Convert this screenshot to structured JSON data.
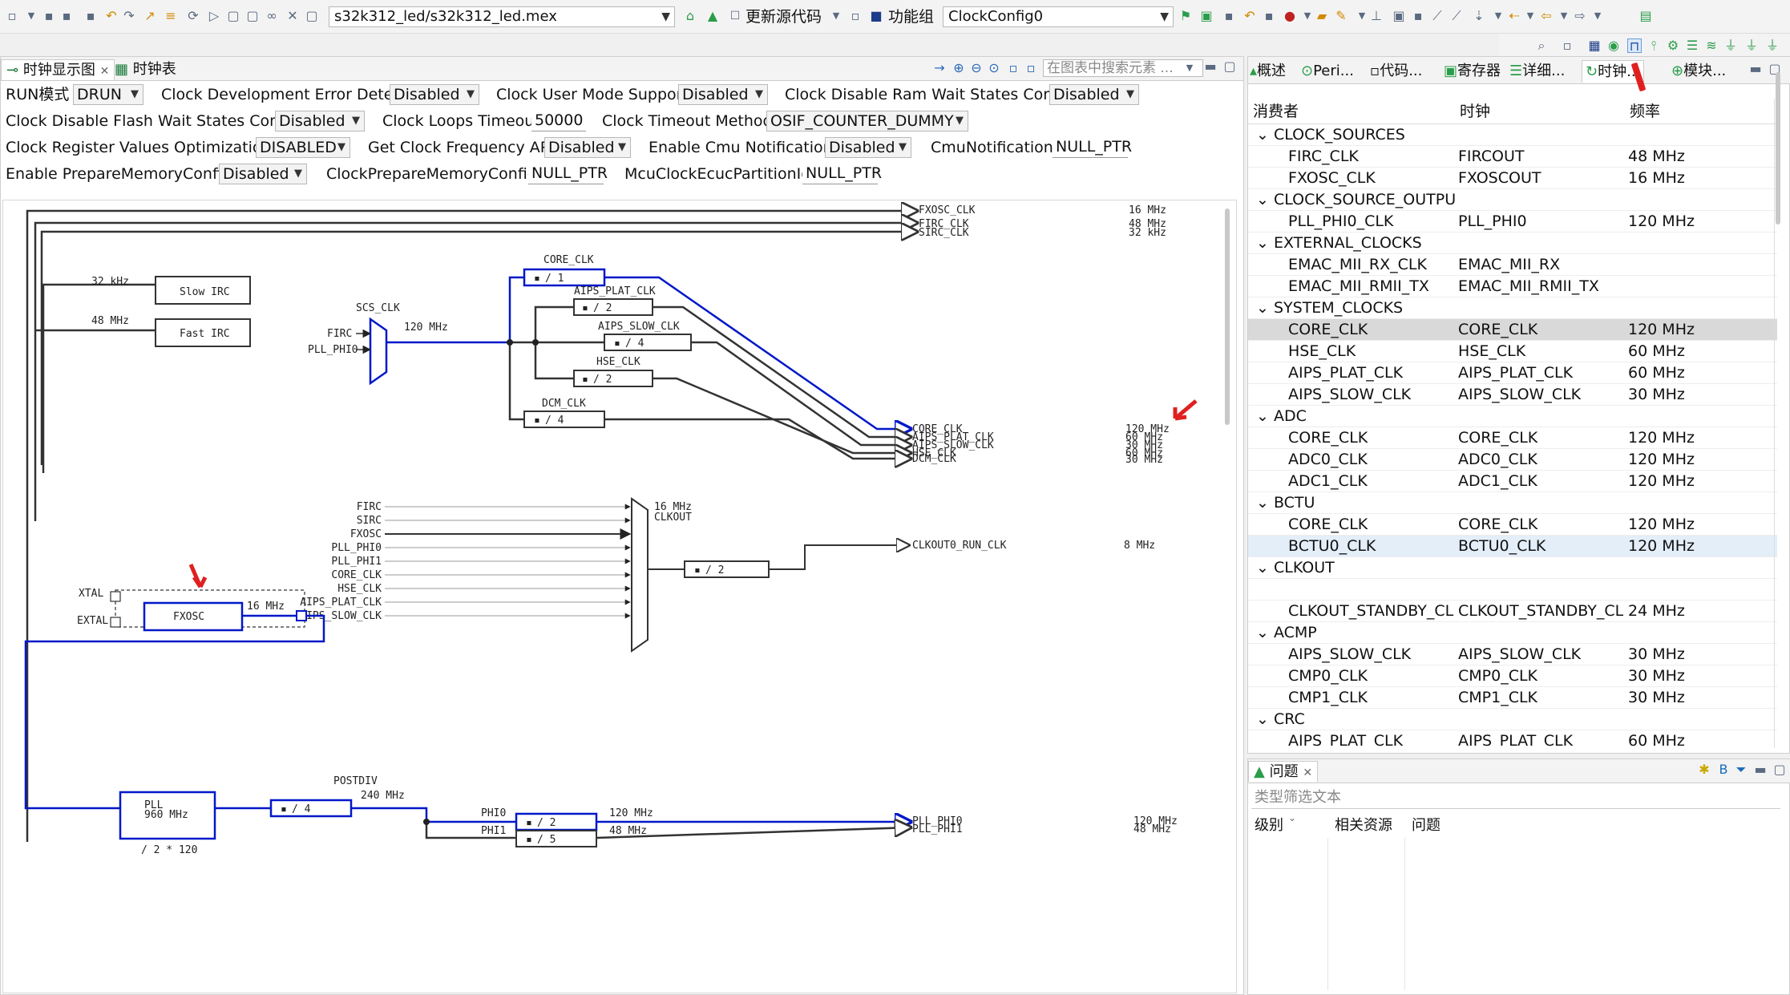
{
  "toolbar": {
    "project_path": "s32k312_led/s32k312_led.mex",
    "update_code_label": "更新源代码",
    "function_group_label": "功能组",
    "function_group_value": "ClockConfig0"
  },
  "left_tabs": {
    "tab1": "时钟显示图",
    "tab2": "时钟表",
    "search_placeholder": "在图表中搜索元素 ..."
  },
  "config": {
    "run_mode_label": "RUN模式",
    "run_mode_value": "DRUN",
    "clock_dev_err_label": "Clock Development Error Detect",
    "clock_dev_err_value": "Disabled",
    "clock_user_mode_label": "Clock User Mode Support",
    "clock_user_mode_value": "Disabled",
    "clock_ram_ws_label": "Clock Disable Ram Wait States Config",
    "clock_ram_ws_value": "Disabled",
    "clock_flash_ws_label": "Clock Disable Flash Wait States Config",
    "clock_flash_ws_value": "Disabled",
    "clock_loops_label": "Clock Loops Timeout",
    "clock_loops_value": "50000",
    "clock_timeout_label": "Clock Timeout Method",
    "clock_timeout_value": "OSIF_COUNTER_DUMMY",
    "clock_reg_opt_label": "Clock Register Values Optimization",
    "clock_reg_opt_value": "DISABLED",
    "get_freq_label": "Get Clock Frequency API",
    "get_freq_value": "Disabled",
    "cmu_notif_label": "Enable Cmu Notification",
    "cmu_notif_value": "Disabled",
    "cmu_notification_label": "CmuNotification",
    "cmu_notification_value": "NULL_PTR",
    "prepare_mem_label": "Enable PrepareMemoryConfig",
    "prepare_mem_value": "Disabled",
    "clock_prepare_mem_label": "ClockPrepareMemoryConfig",
    "clock_prepare_mem_value": "NULL_PTR",
    "mcu_partition_label": "McuClockEcucPartitionId",
    "mcu_partition_value": "NULL_PTR"
  },
  "diagram": {
    "fxosc_clk": "FXOSC_CLK",
    "fxosc_freq": "16 MHz",
    "firc_clk": "FIRC_CLK",
    "firc_freq": "48 MHz",
    "sirc_clk": "SIRC_CLK",
    "sirc_freq": "32 kHz",
    "slow_irc_freq": "32 kHz",
    "slow_irc": "Slow IRC",
    "fast_irc_freq": "48 MHz",
    "fast_irc": "Fast IRC",
    "scs_clk": "SCS_CLK",
    "scs_in1": "FIRC",
    "scs_in2": "PLL_PHI0",
    "scs_out_freq": "120 MHz",
    "core_clk_div_label": "CORE_CLK",
    "core_div": "/ 1",
    "aips_plat_div_label": "AIPS_PLAT_CLK",
    "aips_plat_div": "/ 2",
    "aips_slow_div_label": "AIPS_SLOW_CLK",
    "aips_slow_div": "/ 4",
    "hse_div_label": "HSE_CLK",
    "hse_div": "/ 2",
    "dcm_div_label": "DCM_CLK",
    "dcm_div": "/ 4",
    "out_core": "CORE_CLK",
    "out_aips_plat": "AIPS_PLAT_CLK",
    "out_aips_slow": "AIPS_SLOW_CLK",
    "out_hse": "HSE_CLK",
    "out_dcm": "DCM_CLK",
    "out_f1": "120 MHz",
    "out_f2": "60 MHz",
    "out_f3": "30 MHz",
    "out_f4": "60 MHz",
    "out_f5": "30 MHz",
    "clkout_inputs": [
      "FIRC",
      "SIRC",
      "FXOSC",
      "PLL_PHI0",
      "PLL_PHI1",
      "CORE_CLK",
      "HSE_CLK",
      "AIPS_PLAT_CLK",
      "AIPS_SLOW_CLK"
    ],
    "clkout_mux_freq": "16 MHz",
    "clkout_mux_label": "CLKOUT",
    "clkout_div": "/ 2",
    "clkout_out": "CLKOUT0_RUN_CLK",
    "clkout_freq": "8 MHz",
    "xtal": "XTAL",
    "extal": "EXTAL",
    "fxosc_block": "FXOSC",
    "fxosc_out_freq": "16 MHz",
    "pll_label": "PLL",
    "pll_freq": "960 MHz",
    "pll_mult": "/ 2 * 120",
    "postdiv_label": "POSTDIV",
    "postdiv": "/ 4",
    "postdiv_freq": "240 MHz",
    "phi0_label": "PHI0",
    "phi0_div": "/ 2",
    "phi0_freq": "120 MHz",
    "phi1_label": "PHI1",
    "phi1_div": "/ 5",
    "phi1_freq": "48 MHz",
    "pll_phi0_out": "PLL_PHI0",
    "pll_phi1_out": "PLL_PHI1",
    "pll_phi0_freq": "120 MHz",
    "pll_phi1_freq": "48 MHz"
  },
  "right_tabs": {
    "t1": "概述",
    "t2": "Peri...",
    "t3": "代码...",
    "t4": "寄存器",
    "t5": "详细...",
    "t6": "时钟...",
    "t7": "模块..."
  },
  "table": {
    "headers": [
      "消费者",
      "时钟",
      "频率"
    ],
    "rows": [
      {
        "type": "group",
        "c1": "CLOCK_SOURCES",
        "c2": "",
        "c3": ""
      },
      {
        "type": "item",
        "c1": "FIRC_CLK",
        "c2": "FIRCOUT",
        "c3": "48 MHz"
      },
      {
        "type": "item",
        "c1": "FXOSC_CLK",
        "c2": "FXOSCOUT",
        "c3": "16 MHz"
      },
      {
        "type": "group",
        "c1": "CLOCK_SOURCE_OUTPUTS",
        "c2": "",
        "c3": ""
      },
      {
        "type": "item",
        "c1": "PLL_PHI0_CLK",
        "c2": "PLL_PHI0",
        "c3": "120 MHz"
      },
      {
        "type": "group",
        "c1": "EXTERNAL_CLOCKS",
        "c2": "",
        "c3": ""
      },
      {
        "type": "item",
        "c1": "EMAC_MII_RX_CLK",
        "c2": "EMAC_MII_RX",
        "c3": ""
      },
      {
        "type": "item",
        "c1": "EMAC_MII_RMII_TX",
        "c2": "EMAC_MII_RMII_TX",
        "c3": ""
      },
      {
        "type": "group",
        "c1": "SYSTEM_CLOCKS",
        "c2": "",
        "c3": ""
      },
      {
        "type": "item",
        "c1": "CORE_CLK",
        "c2": "CORE_CLK",
        "c3": "120 MHz",
        "sel": true
      },
      {
        "type": "item",
        "c1": "HSE_CLK",
        "c2": "HSE_CLK",
        "c3": "60 MHz"
      },
      {
        "type": "item",
        "c1": "AIPS_PLAT_CLK",
        "c2": "AIPS_PLAT_CLK",
        "c3": "60 MHz"
      },
      {
        "type": "item",
        "c1": "AIPS_SLOW_CLK",
        "c2": "AIPS_SLOW_CLK",
        "c3": "30 MHz"
      },
      {
        "type": "group",
        "c1": "ADC",
        "c2": "",
        "c3": ""
      },
      {
        "type": "item",
        "c1": "CORE_CLK",
        "c2": "CORE_CLK",
        "c3": "120 MHz"
      },
      {
        "type": "item",
        "c1": "ADC0_CLK",
        "c2": "ADC0_CLK",
        "c3": "120 MHz"
      },
      {
        "type": "item",
        "c1": "ADC1_CLK",
        "c2": "ADC1_CLK",
        "c3": "120 MHz"
      },
      {
        "type": "group",
        "c1": "BCTU",
        "c2": "",
        "c3": ""
      },
      {
        "type": "item",
        "c1": "CORE_CLK",
        "c2": "CORE_CLK",
        "c3": "120 MHz"
      },
      {
        "type": "item",
        "c1": "BCTU0_CLK",
        "c2": "BCTU0_CLK",
        "c3": "120 MHz",
        "hl": true
      },
      {
        "type": "group",
        "c1": "CLKOUT",
        "c2": "",
        "c3": ""
      },
      {
        "type": "item",
        "c1": "",
        "c2": "",
        "c3": ""
      },
      {
        "type": "item",
        "c1": "CLKOUT_STANDBY_CLK",
        "c2": "CLKOUT_STANDBY_CLK",
        "c3": "24 MHz"
      },
      {
        "type": "group",
        "c1": "ACMP",
        "c2": "",
        "c3": ""
      },
      {
        "type": "item",
        "c1": "AIPS_SLOW_CLK",
        "c2": "AIPS_SLOW_CLK",
        "c3": "30 MHz"
      },
      {
        "type": "item",
        "c1": "CMP0_CLK",
        "c2": "CMP0_CLK",
        "c3": "30 MHz"
      },
      {
        "type": "item",
        "c1": "CMP1_CLK",
        "c2": "CMP1_CLK",
        "c3": "30 MHz"
      },
      {
        "type": "group",
        "c1": "CRC",
        "c2": "",
        "c3": ""
      },
      {
        "type": "item",
        "c1": "AIPS_PLAT_CLK",
        "c2": "AIPS_PLAT_CLK",
        "c3": "60 MHz"
      }
    ]
  },
  "problems": {
    "tab": "问题",
    "filter_placeholder": "类型筛选文本",
    "col1": "级别",
    "col2": "相关资源",
    "col3": "问题"
  }
}
